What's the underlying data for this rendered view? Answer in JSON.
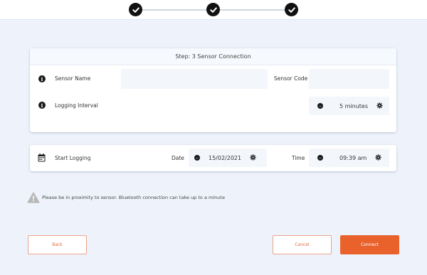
{
  "stepper": {
    "steps": [
      {
        "state": "complete",
        "icon": "check-icon"
      },
      {
        "state": "complete",
        "icon": "check-icon"
      },
      {
        "state": "complete",
        "icon": "check-icon"
      }
    ]
  },
  "sensor_card": {
    "title": "Step: 3 Sensor Connection",
    "sensor_name_label": "Sensor Name",
    "sensor_name_value": "",
    "sensor_code_label": "Sensor Code",
    "sensor_code_value": "",
    "logging_interval_label": "Logging Interval",
    "logging_interval_value": "5 minutes"
  },
  "logging_card": {
    "start_logging_label": "Start Logging",
    "date_label": "Date",
    "date_value": "15/02/2021",
    "time_label": "Time",
    "time_value": "09:39 am"
  },
  "notice": {
    "icon": "warning-icon",
    "text": "Please be in proximity to sensor. Bluetooth connection can take up to a minute"
  },
  "buttons": {
    "back": "Back",
    "cancel": "Cancel",
    "connect": "Connect"
  },
  "colors": {
    "accent": "#e9622c",
    "background": "#eef3fb",
    "field": "#f3f7fc"
  }
}
